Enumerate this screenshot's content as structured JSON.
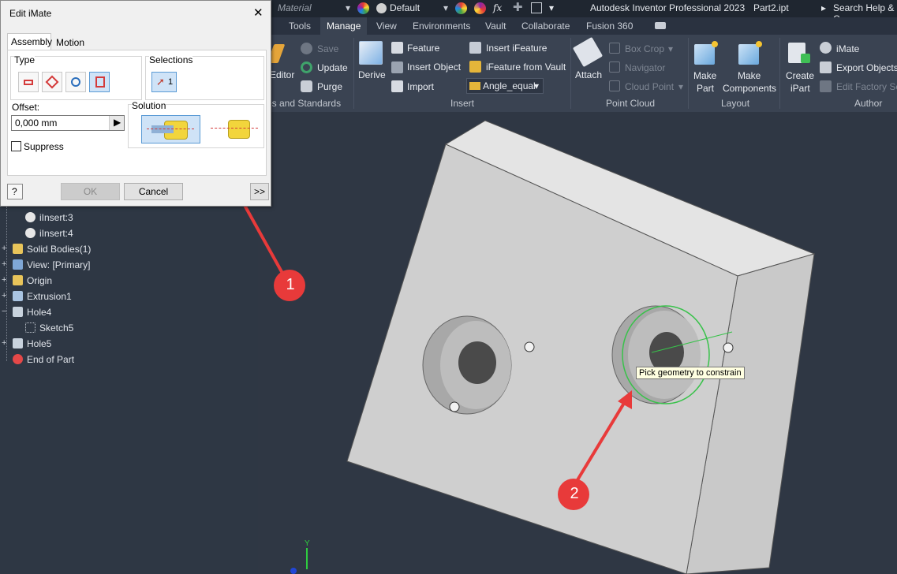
{
  "app": {
    "title": "Autodesk Inventor Professional 2023",
    "document": "Part2.ipt",
    "search": "Search Help & C",
    "material": "Material",
    "appearance": "Default"
  },
  "tabs": [
    "Tools",
    "Manage",
    "View",
    "Environments",
    "Vault",
    "Collaborate",
    "Fusion 360"
  ],
  "active_tab": "Manage",
  "ribbon": {
    "styles": {
      "editor": "Editor",
      "save": "Save",
      "update": "Update",
      "purge": "Purge",
      "group": "es and Standards"
    },
    "insert": {
      "derive": "Derive",
      "feature": "Feature",
      "insert_object": "Insert Object",
      "import": "Import",
      "insert_ifeature": "Insert iFeature",
      "ifeature_vault": "iFeature from Vault",
      "angle_equal": "Angle_equal",
      "group": "Insert"
    },
    "point_cloud": {
      "attach": "Attach",
      "box_crop": "Box Crop",
      "navigator": "Navigator",
      "cloud_point": "Cloud Point",
      "group": "Point Cloud"
    },
    "layout": {
      "make_part": "Make\nPart",
      "make_components": "Make\nComponents",
      "group": "Layout",
      "make_part_1": "Make",
      "make_part_2": "Part",
      "make_comp_1": "Make",
      "make_comp_2": "Components"
    },
    "author": {
      "create_ipart_1": "Create",
      "create_ipart_2": "iPart",
      "imate": "iMate",
      "export_objects": "Export Objects",
      "edit_factory": "Edit Factory Sc",
      "group": "Author"
    }
  },
  "browser": {
    "items": [
      {
        "label": "iInsert:3",
        "indent": 1
      },
      {
        "label": "iInsert:4",
        "indent": 1
      },
      {
        "label": "Solid Bodies(1)",
        "indent": 0
      },
      {
        "label": "View: [Primary]",
        "indent": 0
      },
      {
        "label": "Origin",
        "indent": 0
      },
      {
        "label": "Extrusion1",
        "indent": 0
      },
      {
        "label": "Hole4",
        "indent": 0
      },
      {
        "label": "Sketch5",
        "indent": 1
      },
      {
        "label": "Hole5",
        "indent": 0
      },
      {
        "label": "End of Part",
        "indent": 0
      }
    ]
  },
  "dialog": {
    "title": "Edit iMate",
    "tabs": [
      "Assembly",
      "Motion"
    ],
    "type_label": "Type",
    "selections_label": "Selections",
    "selection_count": "1",
    "offset_label": "Offset:",
    "offset_value": "0,000 mm",
    "solution_label": "Solution",
    "suppress_label": "Suppress",
    "ok": "OK",
    "cancel": "Cancel",
    "more": ">>",
    "help": "?"
  },
  "tooltip": "Pick geometry to constrain",
  "callouts": [
    "1",
    "2"
  ],
  "axis_label": "Y",
  "colors": {
    "callout": "#e83a3a",
    "accent": "#2a6ebd",
    "highlight": "#38c24a"
  }
}
